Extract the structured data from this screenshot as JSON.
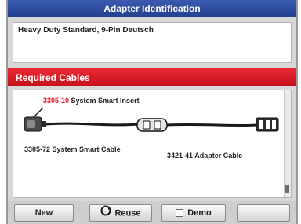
{
  "window": {
    "title": "Adapter Identification"
  },
  "info": {
    "text": "Heavy Duty Standard, 9-Pin Deutsch"
  },
  "banner": {
    "title": "Required Cables"
  },
  "parts": {
    "smart_insert_number": "3305-10",
    "smart_insert_name": " System Smart Insert",
    "smart_cable": "3305-72 System Smart Cable",
    "adapter_cable": "3421-41 Adapter Cable"
  },
  "buttons": {
    "new": "New",
    "reuse": "Reuse",
    "demo": "Demo"
  },
  "colors": {
    "title_bar": "#2a4ba0",
    "banner": "#d81c26",
    "part_number_highlight": "#e21a28"
  },
  "icons": {
    "reuse": "recycle-icon",
    "demo": "checkbox"
  }
}
